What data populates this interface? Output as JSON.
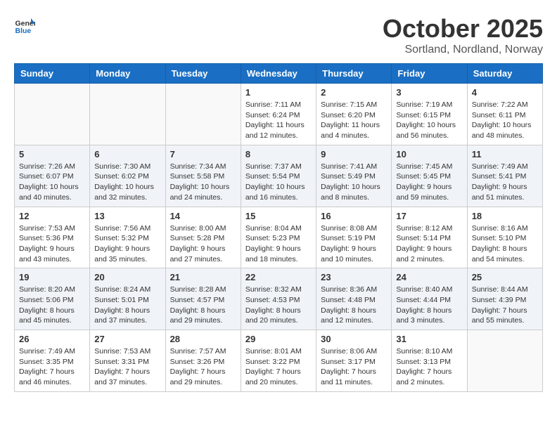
{
  "header": {
    "logo_general": "General",
    "logo_blue": "Blue",
    "month": "October 2025",
    "location": "Sortland, Nordland, Norway"
  },
  "days_of_week": [
    "Sunday",
    "Monday",
    "Tuesday",
    "Wednesday",
    "Thursday",
    "Friday",
    "Saturday"
  ],
  "weeks": [
    {
      "shade": false,
      "days": [
        {
          "num": "",
          "empty": true,
          "detail": ""
        },
        {
          "num": "",
          "empty": true,
          "detail": ""
        },
        {
          "num": "",
          "empty": true,
          "detail": ""
        },
        {
          "num": "1",
          "empty": false,
          "detail": "Sunrise: 7:11 AM\nSunset: 6:24 PM\nDaylight: 11 hours\nand 12 minutes."
        },
        {
          "num": "2",
          "empty": false,
          "detail": "Sunrise: 7:15 AM\nSunset: 6:20 PM\nDaylight: 11 hours\nand 4 minutes."
        },
        {
          "num": "3",
          "empty": false,
          "detail": "Sunrise: 7:19 AM\nSunset: 6:15 PM\nDaylight: 10 hours\nand 56 minutes."
        },
        {
          "num": "4",
          "empty": false,
          "detail": "Sunrise: 7:22 AM\nSunset: 6:11 PM\nDaylight: 10 hours\nand 48 minutes."
        }
      ]
    },
    {
      "shade": true,
      "days": [
        {
          "num": "5",
          "empty": false,
          "detail": "Sunrise: 7:26 AM\nSunset: 6:07 PM\nDaylight: 10 hours\nand 40 minutes."
        },
        {
          "num": "6",
          "empty": false,
          "detail": "Sunrise: 7:30 AM\nSunset: 6:02 PM\nDaylight: 10 hours\nand 32 minutes."
        },
        {
          "num": "7",
          "empty": false,
          "detail": "Sunrise: 7:34 AM\nSunset: 5:58 PM\nDaylight: 10 hours\nand 24 minutes."
        },
        {
          "num": "8",
          "empty": false,
          "detail": "Sunrise: 7:37 AM\nSunset: 5:54 PM\nDaylight: 10 hours\nand 16 minutes."
        },
        {
          "num": "9",
          "empty": false,
          "detail": "Sunrise: 7:41 AM\nSunset: 5:49 PM\nDaylight: 10 hours\nand 8 minutes."
        },
        {
          "num": "10",
          "empty": false,
          "detail": "Sunrise: 7:45 AM\nSunset: 5:45 PM\nDaylight: 9 hours\nand 59 minutes."
        },
        {
          "num": "11",
          "empty": false,
          "detail": "Sunrise: 7:49 AM\nSunset: 5:41 PM\nDaylight: 9 hours\nand 51 minutes."
        }
      ]
    },
    {
      "shade": false,
      "days": [
        {
          "num": "12",
          "empty": false,
          "detail": "Sunrise: 7:53 AM\nSunset: 5:36 PM\nDaylight: 9 hours\nand 43 minutes."
        },
        {
          "num": "13",
          "empty": false,
          "detail": "Sunrise: 7:56 AM\nSunset: 5:32 PM\nDaylight: 9 hours\nand 35 minutes."
        },
        {
          "num": "14",
          "empty": false,
          "detail": "Sunrise: 8:00 AM\nSunset: 5:28 PM\nDaylight: 9 hours\nand 27 minutes."
        },
        {
          "num": "15",
          "empty": false,
          "detail": "Sunrise: 8:04 AM\nSunset: 5:23 PM\nDaylight: 9 hours\nand 18 minutes."
        },
        {
          "num": "16",
          "empty": false,
          "detail": "Sunrise: 8:08 AM\nSunset: 5:19 PM\nDaylight: 9 hours\nand 10 minutes."
        },
        {
          "num": "17",
          "empty": false,
          "detail": "Sunrise: 8:12 AM\nSunset: 5:14 PM\nDaylight: 9 hours\nand 2 minutes."
        },
        {
          "num": "18",
          "empty": false,
          "detail": "Sunrise: 8:16 AM\nSunset: 5:10 PM\nDaylight: 8 hours\nand 54 minutes."
        }
      ]
    },
    {
      "shade": true,
      "days": [
        {
          "num": "19",
          "empty": false,
          "detail": "Sunrise: 8:20 AM\nSunset: 5:06 PM\nDaylight: 8 hours\nand 45 minutes."
        },
        {
          "num": "20",
          "empty": false,
          "detail": "Sunrise: 8:24 AM\nSunset: 5:01 PM\nDaylight: 8 hours\nand 37 minutes."
        },
        {
          "num": "21",
          "empty": false,
          "detail": "Sunrise: 8:28 AM\nSunset: 4:57 PM\nDaylight: 8 hours\nand 29 minutes."
        },
        {
          "num": "22",
          "empty": false,
          "detail": "Sunrise: 8:32 AM\nSunset: 4:53 PM\nDaylight: 8 hours\nand 20 minutes."
        },
        {
          "num": "23",
          "empty": false,
          "detail": "Sunrise: 8:36 AM\nSunset: 4:48 PM\nDaylight: 8 hours\nand 12 minutes."
        },
        {
          "num": "24",
          "empty": false,
          "detail": "Sunrise: 8:40 AM\nSunset: 4:44 PM\nDaylight: 8 hours\nand 3 minutes."
        },
        {
          "num": "25",
          "empty": false,
          "detail": "Sunrise: 8:44 AM\nSunset: 4:39 PM\nDaylight: 7 hours\nand 55 minutes."
        }
      ]
    },
    {
      "shade": false,
      "days": [
        {
          "num": "26",
          "empty": false,
          "detail": "Sunrise: 7:49 AM\nSunset: 3:35 PM\nDaylight: 7 hours\nand 46 minutes."
        },
        {
          "num": "27",
          "empty": false,
          "detail": "Sunrise: 7:53 AM\nSunset: 3:31 PM\nDaylight: 7 hours\nand 37 minutes."
        },
        {
          "num": "28",
          "empty": false,
          "detail": "Sunrise: 7:57 AM\nSunset: 3:26 PM\nDaylight: 7 hours\nand 29 minutes."
        },
        {
          "num": "29",
          "empty": false,
          "detail": "Sunrise: 8:01 AM\nSunset: 3:22 PM\nDaylight: 7 hours\nand 20 minutes."
        },
        {
          "num": "30",
          "empty": false,
          "detail": "Sunrise: 8:06 AM\nSunset: 3:17 PM\nDaylight: 7 hours\nand 11 minutes."
        },
        {
          "num": "31",
          "empty": false,
          "detail": "Sunrise: 8:10 AM\nSunset: 3:13 PM\nDaylight: 7 hours\nand 2 minutes."
        },
        {
          "num": "",
          "empty": true,
          "detail": ""
        }
      ]
    }
  ]
}
